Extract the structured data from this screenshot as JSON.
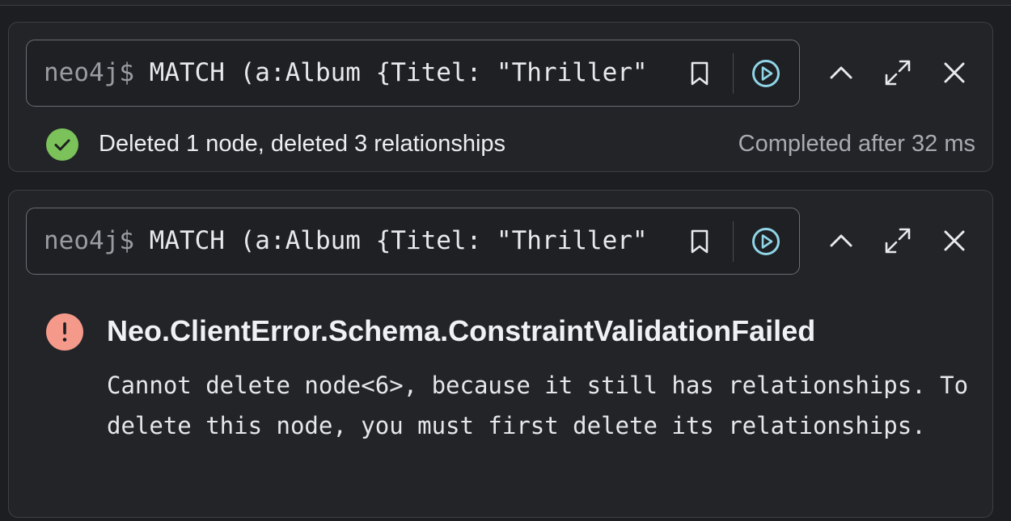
{
  "frames": [
    {
      "prompt": "neo4j$",
      "query": "MATCH (a:Album {Titel: \"Thriller\"",
      "status": {
        "type": "success",
        "icon": "check-circle-icon",
        "message": "Deleted 1 node, deleted 3 relationships",
        "timing": "Completed after 32 ms"
      }
    },
    {
      "prompt": "neo4j$",
      "query": "MATCH (a:Album {Titel: \"Thriller\"",
      "error": {
        "icon": "exclamation-circle-icon",
        "title": "Neo.ClientError.Schema.ConstraintValidationFailed",
        "message": "Cannot delete node<6>, because it still has relationships. To delete this node, you must first delete its relationships."
      }
    }
  ],
  "toolbar_icons": [
    "bookmark-icon",
    "run-icon",
    "collapse-icon",
    "fullscreen-icon",
    "close-icon"
  ],
  "colors": {
    "background": "#1d1e21",
    "frame": "#232428",
    "success": "#7bc25a",
    "error": "#f59a8a",
    "run": "#8fd5e8"
  }
}
